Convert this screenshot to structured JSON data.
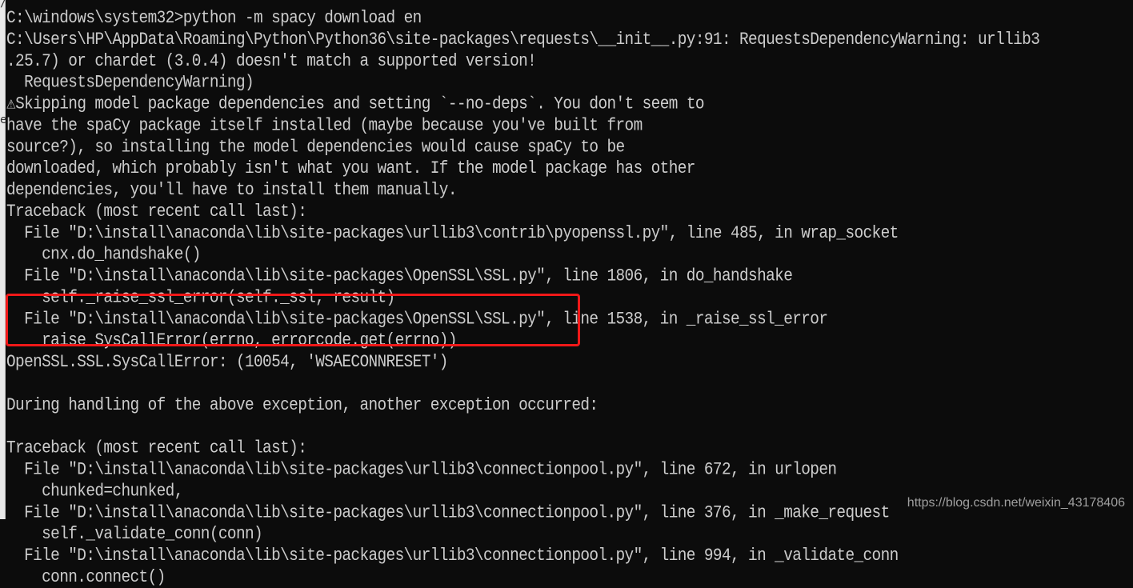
{
  "terminal": {
    "lines": [
      "C:\\windows\\system32>python -m spacy download en",
      "C:\\Users\\HP\\AppData\\Roaming\\Python\\Python36\\site-packages\\requests\\__init__.py:91: RequestsDependencyWarning: urllib3",
      ".25.7) or chardet (3.0.4) doesn't match a supported version!",
      "  RequestsDependencyWarning)",
      "⚠Skipping model package dependencies and setting `--no-deps`. You don't seem to",
      "have the spaCy package itself installed (maybe because you've built from",
      "source?), so installing the model dependencies would cause spaCy to be",
      "downloaded, which probably isn't what you want. If the model package has other",
      "dependencies, you'll have to install them manually.",
      "Traceback (most recent call last):",
      "  File \"D:\\install\\anaconda\\lib\\site-packages\\urllib3\\contrib\\pyopenssl.py\", line 485, in wrap_socket",
      "    cnx.do_handshake()",
      "  File \"D:\\install\\anaconda\\lib\\site-packages\\OpenSSL\\SSL.py\", line 1806, in do_handshake",
      "    self._raise_ssl_error(self._ssl, result)",
      "  File \"D:\\install\\anaconda\\lib\\site-packages\\OpenSSL\\SSL.py\", line 1538, in _raise_ssl_error",
      "    raise SysCallError(errno, errorcode.get(errno))",
      "OpenSSL.SSL.SysCallError: (10054, 'WSAECONNRESET')",
      "",
      "During handling of the above exception, another exception occurred:",
      "",
      "Traceback (most recent call last):",
      "  File \"D:\\install\\anaconda\\lib\\site-packages\\urllib3\\connectionpool.py\", line 672, in urlopen",
      "    chunked=chunked,",
      "  File \"D:\\install\\anaconda\\lib\\site-packages\\urllib3\\connectionpool.py\", line 376, in _make_request",
      "    self._validate_conn(conn)",
      "  File \"D:\\install\\anaconda\\lib\\site-packages\\urllib3\\connectionpool.py\", line 994, in _validate_conn",
      "    conn.connect()"
    ]
  },
  "gutter": {
    "glyphs": [
      "/",
      "e"
    ]
  },
  "watermark": "https://blog.csdn.net/weixin_43178406",
  "colors": {
    "background": "#0c0c0c",
    "text": "#cccccc",
    "highlight": "#f01818"
  }
}
